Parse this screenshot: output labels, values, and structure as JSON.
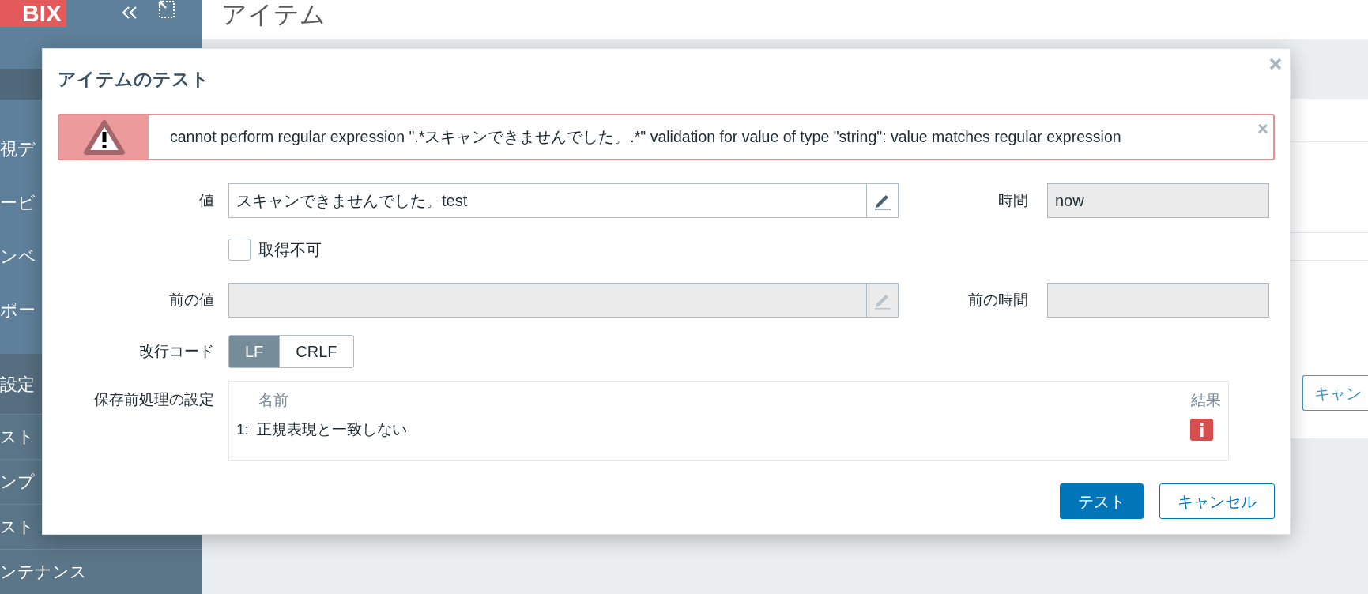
{
  "app": {
    "logo": "BIX"
  },
  "sidebar": {
    "items": [
      {
        "label": "視デ",
        "selected": false
      },
      {
        "label": "ービ",
        "selected": false
      },
      {
        "label": "ンベ",
        "selected": false
      },
      {
        "label": "ポー",
        "selected": false
      },
      {
        "label": "設定",
        "selected": true,
        "expanded": true,
        "children": [
          {
            "label": "スト"
          },
          {
            "label": "ンプ"
          },
          {
            "label": "スト"
          },
          {
            "label": "ンテナンス"
          }
        ]
      }
    ]
  },
  "page": {
    "title": "アイテム",
    "partial_button": "キャン"
  },
  "dialog": {
    "title": "アイテムのテスト",
    "error": {
      "message": "cannot perform regular expression \".*スキャンできませんでした。.*\" validation for value of type \"string\": value matches regular expression"
    },
    "value": {
      "label": "値",
      "value": "スキャンできませんでした。test",
      "disabled": false
    },
    "time": {
      "label": "時間",
      "value": "now",
      "disabled": true
    },
    "not_supported": {
      "label": "取得不可",
      "checked": false
    },
    "prev_value": {
      "label": "前の値",
      "disabled": true
    },
    "prev_time": {
      "label": "前の時間",
      "disabled": true
    },
    "eol": {
      "label": "改行コード",
      "options": [
        {
          "label": "LF",
          "selected": true
        },
        {
          "label": "CRLF",
          "selected": false
        }
      ]
    },
    "preprocessing": {
      "label": "保存前処理の設定",
      "columns": [
        "名前",
        "結果"
      ],
      "steps": [
        {
          "number": "1:",
          "name": "正規表現と一致しない",
          "kind": "error"
        }
      ]
    },
    "buttons": [
      {
        "label": "テスト",
        "kind": "primary"
      },
      {
        "label": "キャンセル",
        "kind": "secondary"
      }
    ]
  }
}
